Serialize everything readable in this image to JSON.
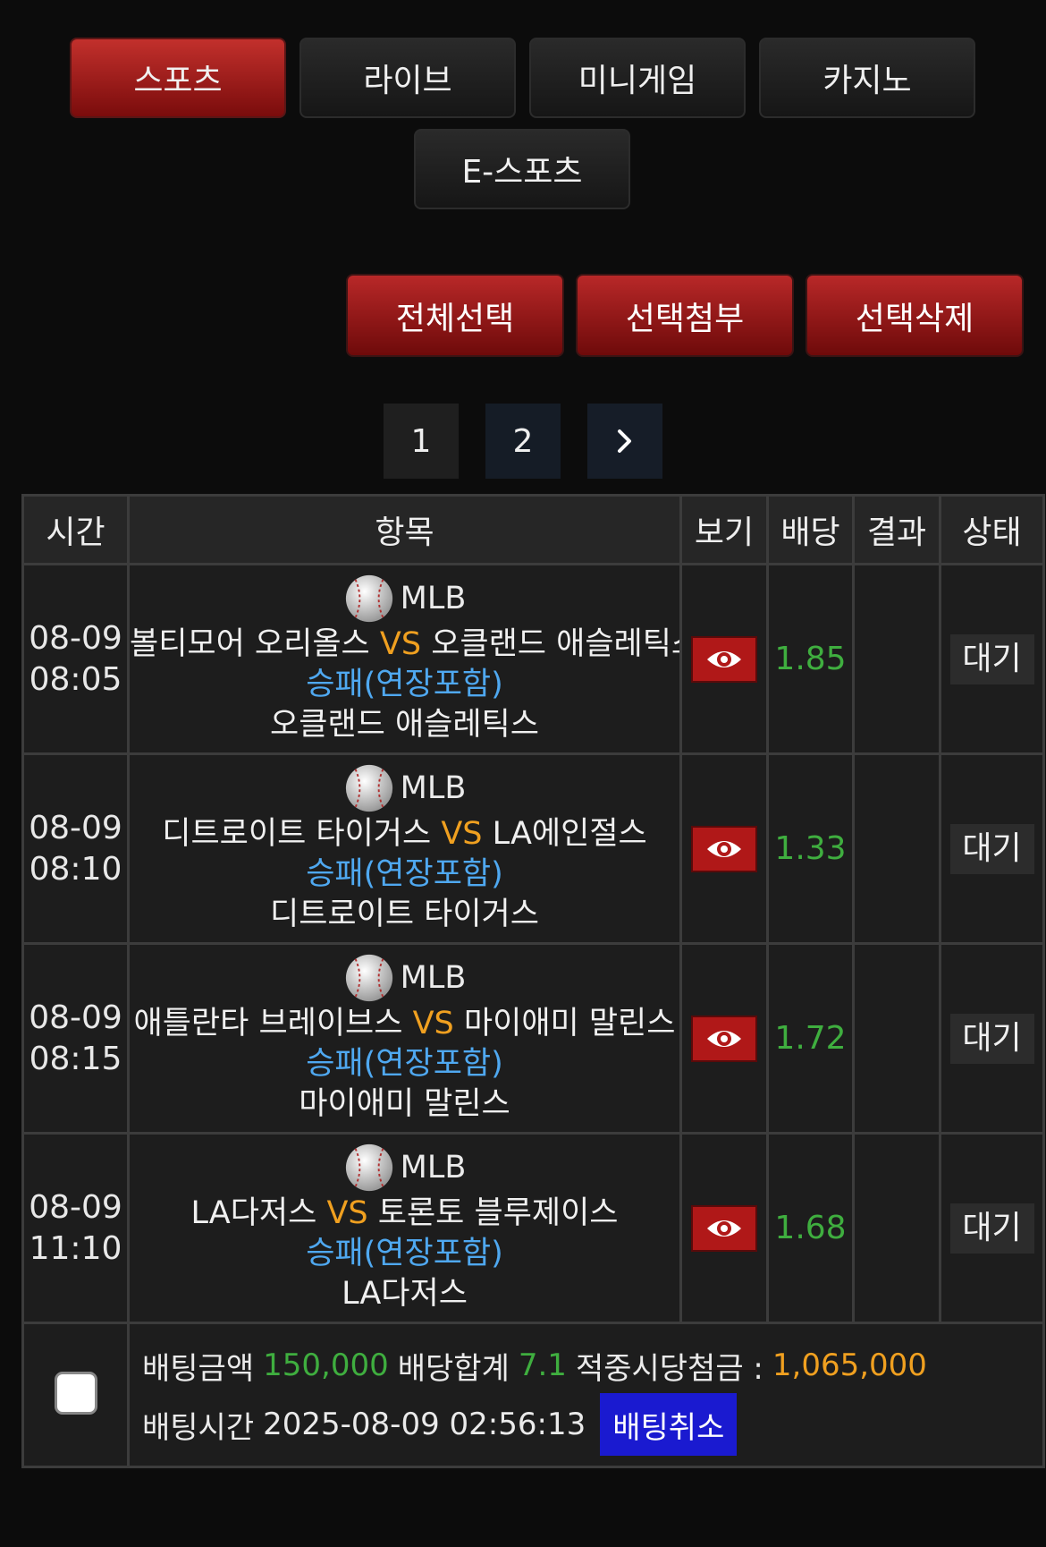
{
  "categories": [
    {
      "label": "스포츠",
      "active": true
    },
    {
      "label": "라이브",
      "active": false
    },
    {
      "label": "미니게임",
      "active": false
    },
    {
      "label": "카지노",
      "active": false
    },
    {
      "label": "E-스포츠",
      "active": false
    }
  ],
  "actions": {
    "select_all": "전체선택",
    "attach_selected": "선택첨부",
    "delete_selected": "선택삭제"
  },
  "pagination": {
    "pages": [
      "1",
      "2"
    ],
    "next_icon": "chevron-right-icon"
  },
  "table": {
    "headers": {
      "time": "시간",
      "item": "항목",
      "view": "보기",
      "odds": "배당",
      "result": "결과",
      "status": "상태"
    },
    "rows": [
      {
        "date": "08-09",
        "time": "08:05",
        "league": "MLB",
        "home": "볼티모어 오리올스",
        "vs": "VS",
        "away": "오클랜드 애슬레틱스",
        "market": "승패(연장포함)",
        "pick": "오클랜드 애슬레틱스",
        "odds": "1.85",
        "result": "",
        "status": "대기"
      },
      {
        "date": "08-09",
        "time": "08:10",
        "league": "MLB",
        "home": "디트로이트 타이거스",
        "vs": "VS",
        "away": "LA에인절스",
        "market": "승패(연장포함)",
        "pick": "디트로이트 타이거스",
        "odds": "1.33",
        "result": "",
        "status": "대기"
      },
      {
        "date": "08-09",
        "time": "08:15",
        "league": "MLB",
        "home": "애틀란타 브레이브스",
        "vs": "VS",
        "away": "마이애미 말린스",
        "market": "승패(연장포함)",
        "pick": "마이애미 말린스",
        "odds": "1.72",
        "result": "",
        "status": "대기"
      },
      {
        "date": "08-09",
        "time": "11:10",
        "league": "MLB",
        "home": "LA다저스",
        "vs": "VS",
        "away": "토론토 블루제이스",
        "market": "승패(연장포함)",
        "pick": "LA다저스",
        "odds": "1.68",
        "result": "",
        "status": "대기"
      }
    ]
  },
  "summary": {
    "bet_amount_label": "배팅금액",
    "bet_amount": "150,000",
    "odds_total_label": "배당합계",
    "odds_total": "7.1",
    "payout_label": "적중시당첨금 :",
    "payout": "1,065,000",
    "bet_time_label": "배팅시간",
    "bet_time": "2025-08-09 02:56:13",
    "cancel_label": "배팅취소"
  },
  "colors": {
    "accent_red": "#b01818",
    "odds_green": "#3fae3f",
    "vs_orange": "#f0a020",
    "market_blue": "#4fa8f0",
    "cancel_blue": "#1a1ad0"
  }
}
